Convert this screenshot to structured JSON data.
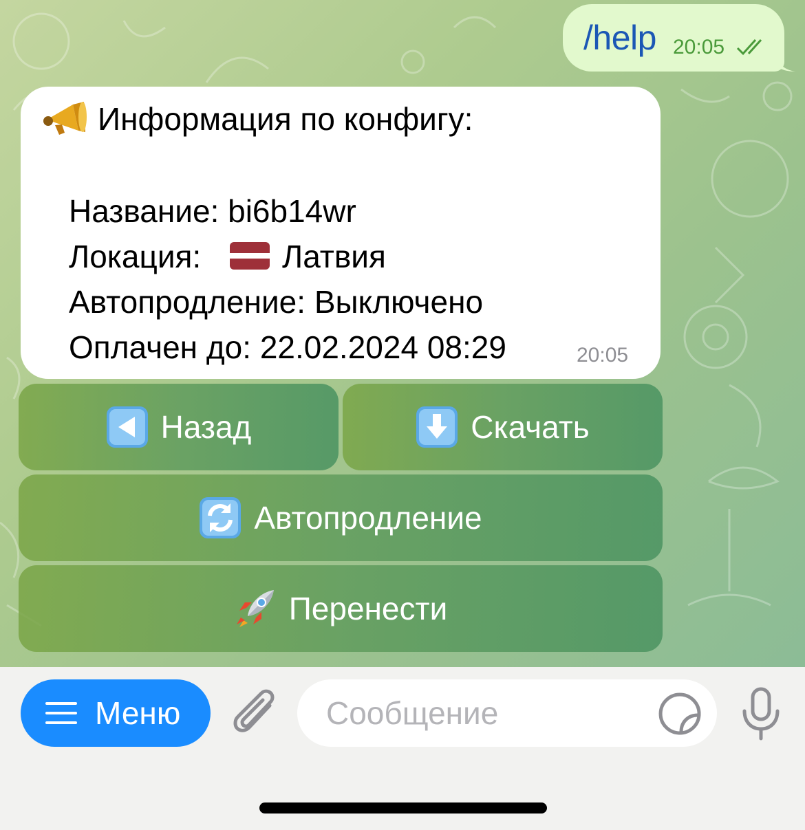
{
  "outgoing": {
    "text": "/help",
    "time": "20:05",
    "status": "read-double-check-icon"
  },
  "incoming": {
    "header_icon": "megaphone-icon",
    "header": "Информация по конфигу:",
    "name_line": "Название: bi6b14wr",
    "location_label": "Локация:",
    "location_flag": "latvia-flag-icon",
    "location_value": "Латвия",
    "autorenew_line": "Автопродление: Выключено",
    "paid_line": "Оплачен до: 22.02.2024 08:29",
    "time": "20:05"
  },
  "keyboard": {
    "back": {
      "label": "Назад",
      "icon": "left-arrow-icon"
    },
    "download": {
      "label": "Скачать",
      "icon": "down-arrow-icon"
    },
    "autorenew": {
      "label": "Автопродление",
      "icon": "arrows-cycle-icon"
    },
    "transfer": {
      "label": "Перенести",
      "icon": "rocket-icon"
    }
  },
  "input_bar": {
    "menu_label": "Меню",
    "placeholder": "Сообщение"
  },
  "colors": {
    "menu_button": "#1a8cff",
    "outgoing_bubble": "#e2f9cd",
    "outgoing_text": "#1b57b5",
    "time_green": "#4a9a3a"
  }
}
